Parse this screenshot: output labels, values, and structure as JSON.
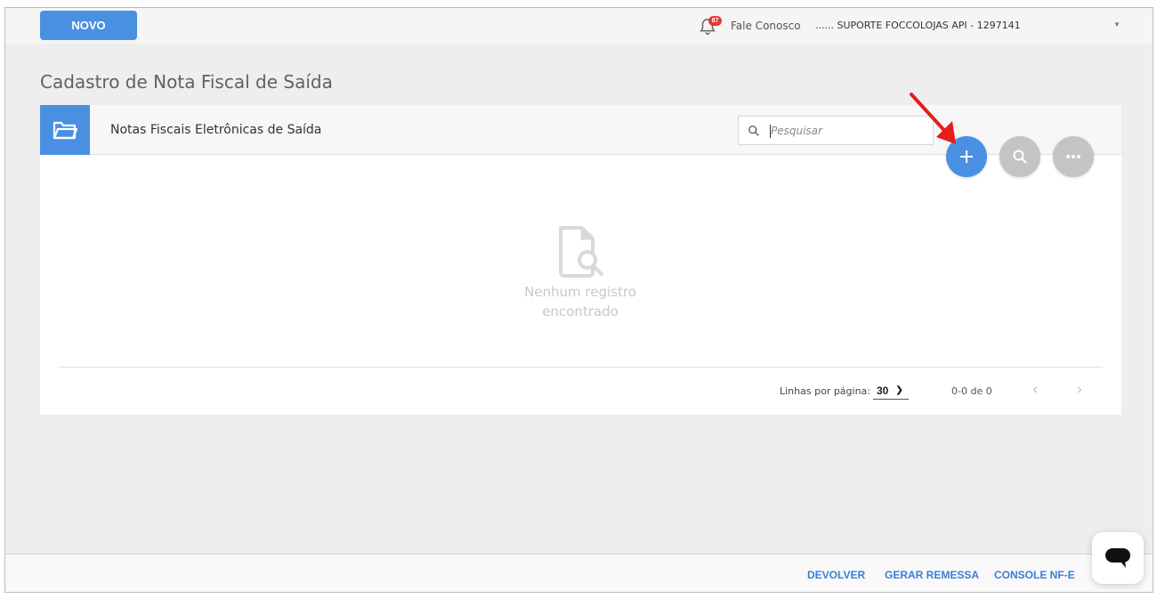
{
  "topbar": {
    "new_button": "NOVO",
    "notifications_count": "87",
    "contact_label": "Fale Conosco",
    "account_label": "...... SUPORTE FOCCOLOJAS API - 1297141"
  },
  "page": {
    "title": "Cadastro de Nota Fiscal de Saída"
  },
  "card": {
    "title": "Notas Fiscais Eletrônicas de Saída",
    "search_placeholder": "Pesquisar",
    "empty_line1": "Nenhum registro",
    "empty_line2": "encontrado"
  },
  "pagination": {
    "rows_label": "Linhas por página:",
    "rows_value": "30",
    "range": "0-0 de 0"
  },
  "footer": {
    "devolver": "DEVOLVER",
    "gerar_remessa": "GERAR REMESSA",
    "console": "CONSOLE NF-E"
  },
  "colors": {
    "primary": "#4a90e2",
    "badge": "#e53935",
    "arrow": "#e81c1c",
    "fab_secondary": "#c4c4c4",
    "footer_link": "#3b7dd8"
  },
  "icons": [
    "bell-icon",
    "folder-icon",
    "search-icon",
    "plus-icon",
    "more-icon",
    "empty-document-search-icon",
    "chevron-left-icon",
    "chevron-right-icon",
    "chat-icon",
    "red-arrow-annotation"
  ]
}
